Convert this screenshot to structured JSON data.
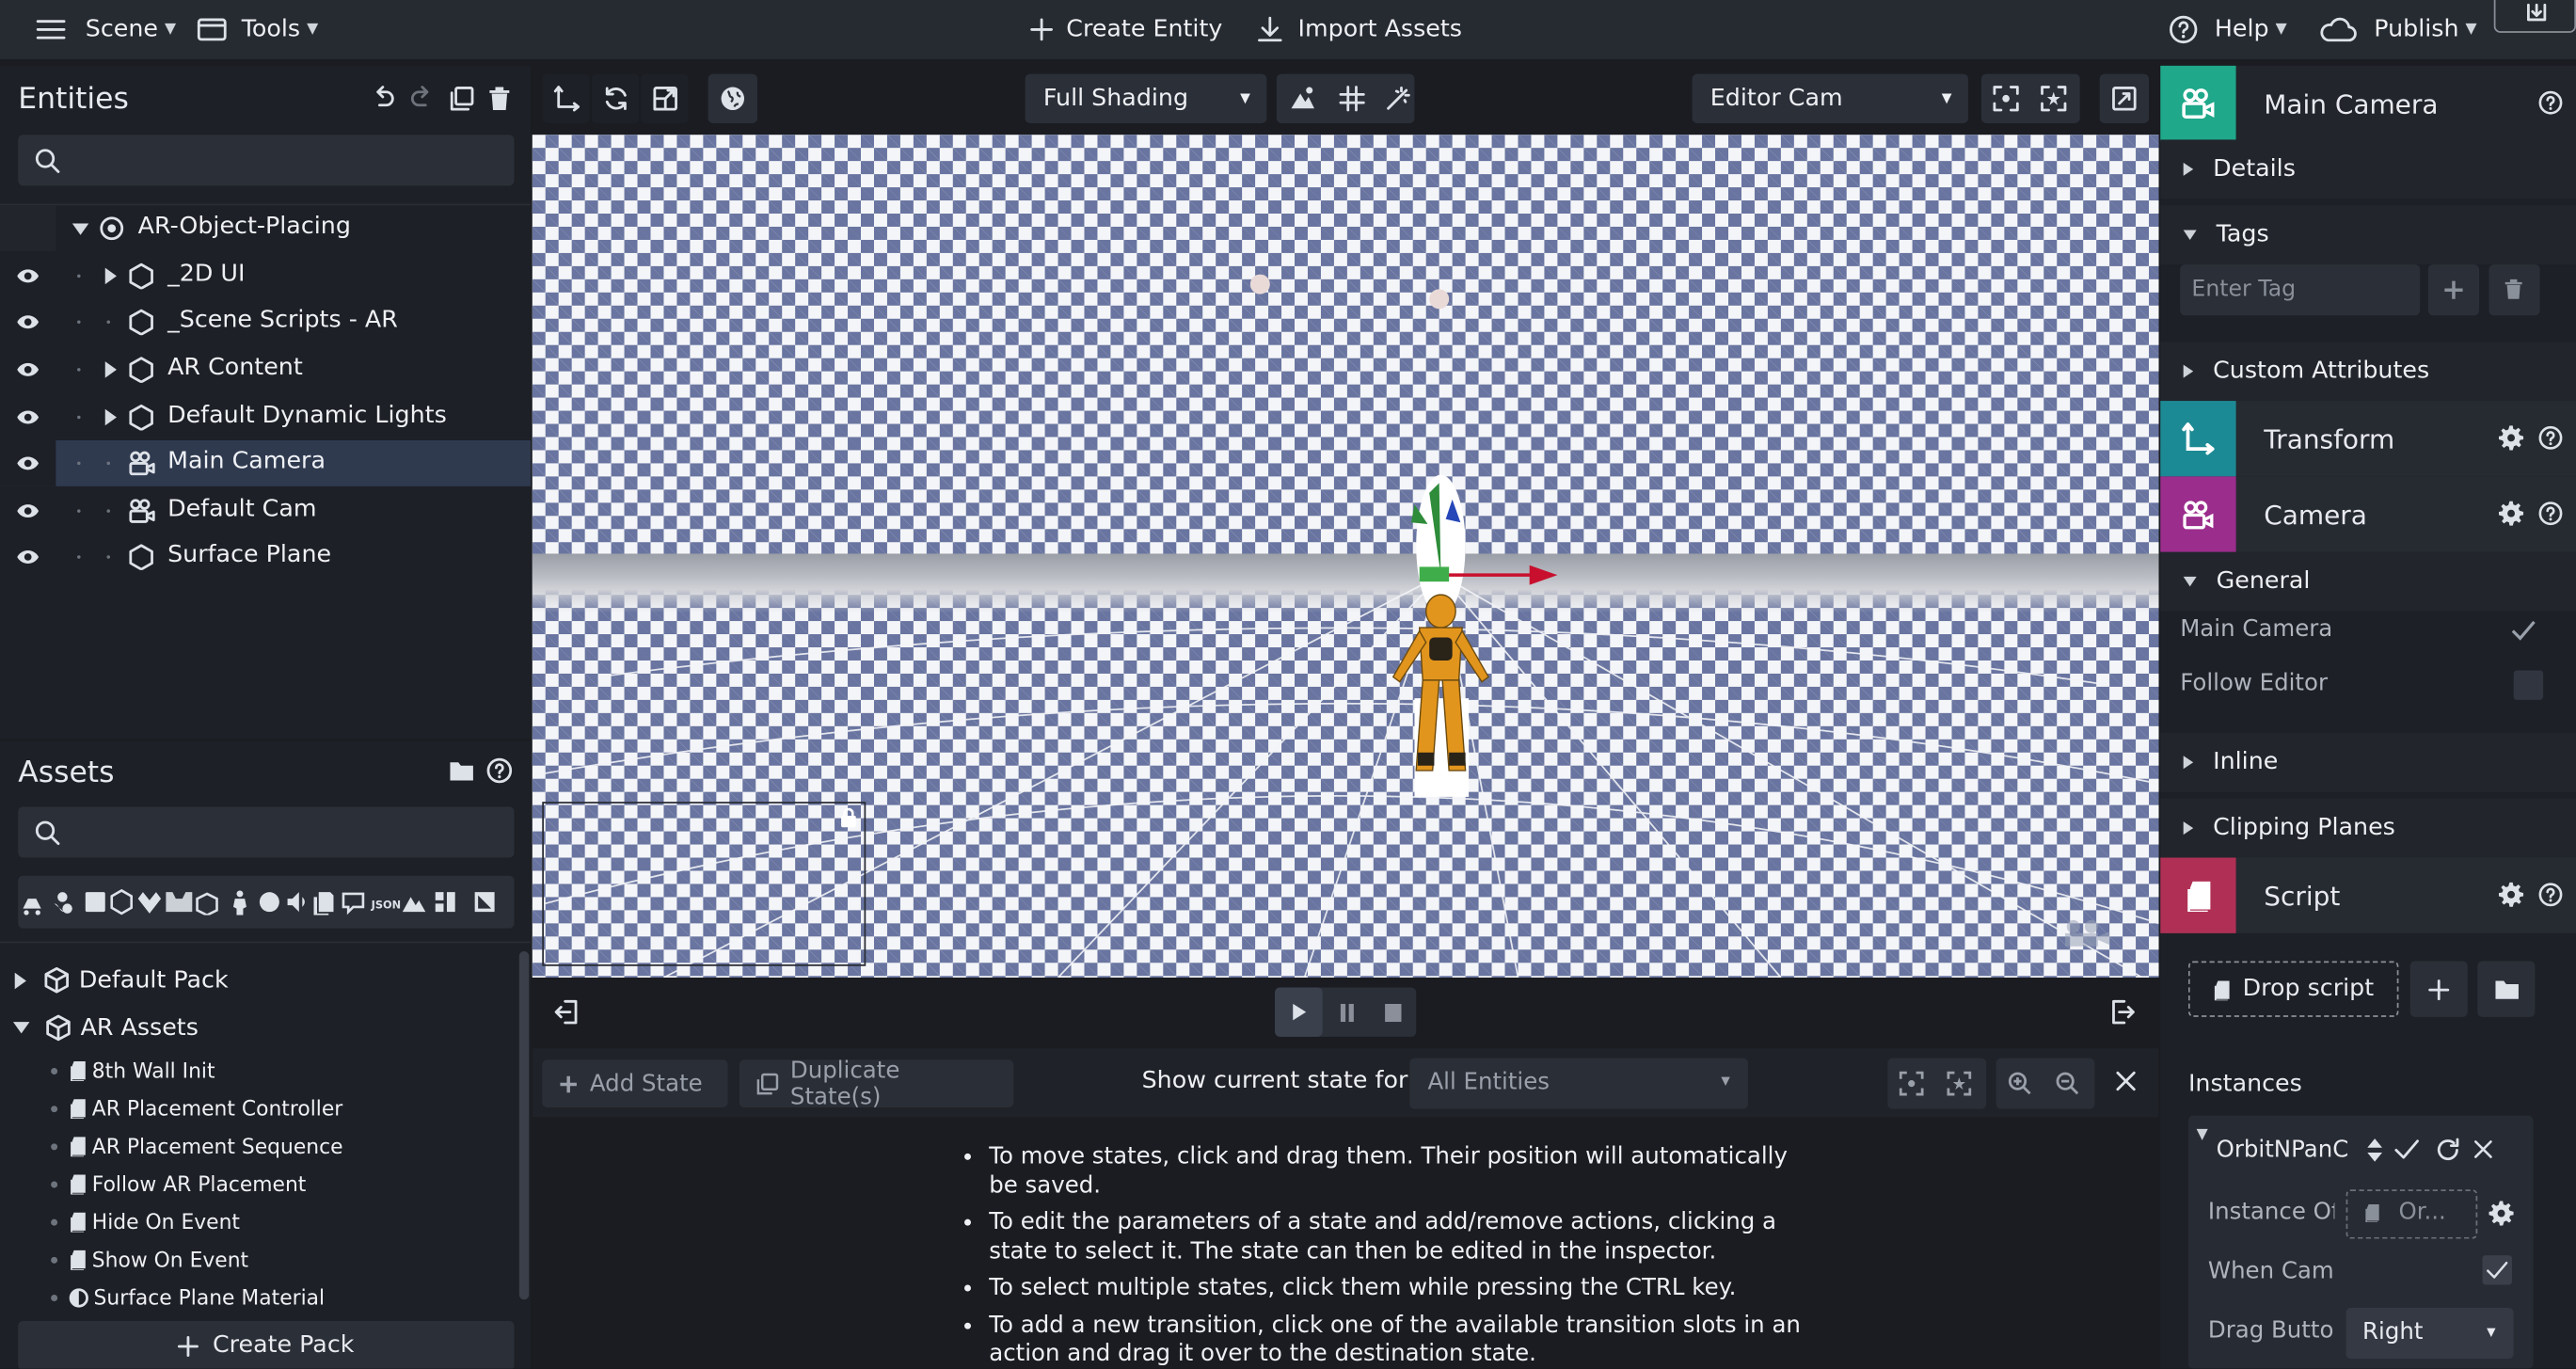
{
  "topbar": {
    "scene_label": "Scene",
    "tools_label": "Tools",
    "create_entity_label": "Create Entity",
    "import_assets_label": "Import Assets",
    "help_label": "Help",
    "publish_label": "Publish"
  },
  "entities": {
    "title": "Entities",
    "search_placeholder": "",
    "items": [
      {
        "label": "AR-Object-Placing"
      },
      {
        "label": "_2D UI"
      },
      {
        "label": "_Scene Scripts - AR"
      },
      {
        "label": "AR Content"
      },
      {
        "label": "Default Dynamic Lights"
      },
      {
        "label": "Main Camera",
        "selected": true
      },
      {
        "label": "Default Cam"
      },
      {
        "label": "Surface Plane"
      }
    ]
  },
  "assets": {
    "title": "Assets",
    "search_placeholder": "",
    "filter_json_label": "JSON",
    "packs": [
      {
        "label": "Default Pack",
        "expanded": false
      },
      {
        "label": "AR Assets",
        "expanded": true
      }
    ],
    "items": [
      {
        "label": "8th Wall Init",
        "icon": "script-icon"
      },
      {
        "label": "AR Placement Controller",
        "icon": "script-icon"
      },
      {
        "label": "AR Placement Sequence",
        "icon": "script-icon"
      },
      {
        "label": "Follow AR Placement",
        "icon": "script-icon"
      },
      {
        "label": "Hide On Event",
        "icon": "script-icon"
      },
      {
        "label": "Show On Event",
        "icon": "script-icon"
      },
      {
        "label": "Surface Plane Material",
        "icon": "material-icon"
      }
    ],
    "create_pack_label": "Create Pack"
  },
  "viewport": {
    "shading_label": "Full Shading",
    "camera_label": "Editor Cam"
  },
  "state_editor": {
    "add_state_label": "Add State",
    "duplicate_state_label": "Duplicate State(s)",
    "show_state_for_label": "Show current state for:",
    "entity_filter_value": "All Entities",
    "help_items": [
      "To move states, click and drag them. Their position will automatically be saved.",
      "To edit the parameters of a state and add/remove actions, clicking a state to select it. The state can then be edited in the inspector.",
      "To select multiple states, click them while pressing the CTRL key.",
      "To add a new transition, click one of the available transition slots in an action and drag it over to the destination state."
    ]
  },
  "inspector": {
    "entity_name": "Main Camera",
    "details_label": "Details",
    "tags_label": "Tags",
    "tag_placeholder": "Enter Tag",
    "custom_attributes_label": "Custom Attributes",
    "transform_label": "Transform",
    "camera_label": "Camera",
    "general_label": "General",
    "main_camera_prop": "Main Camera",
    "main_camera_checked": true,
    "follow_editor_prop": "Follow Editor",
    "follow_editor_checked": false,
    "inline_label": "Inline",
    "clipping_planes_label": "Clipping Planes",
    "script_label": "Script",
    "drop_script_label": "Drop script",
    "instances_label": "Instances",
    "instance_name": "OrbitNPanC",
    "instance_of_label": "Instance Of",
    "instance_of_value": "Or...",
    "when_camera_label": "When Came",
    "when_camera_checked": true,
    "drag_button_label": "Drag Butto",
    "drag_button_value": "Right"
  },
  "colors": {
    "camera_accent": "#1fa88a",
    "transform_accent": "#1c8a94",
    "camera_component_accent": "#9b2d8c",
    "script_accent": "#b03055",
    "selection": "#2f3a4f"
  }
}
